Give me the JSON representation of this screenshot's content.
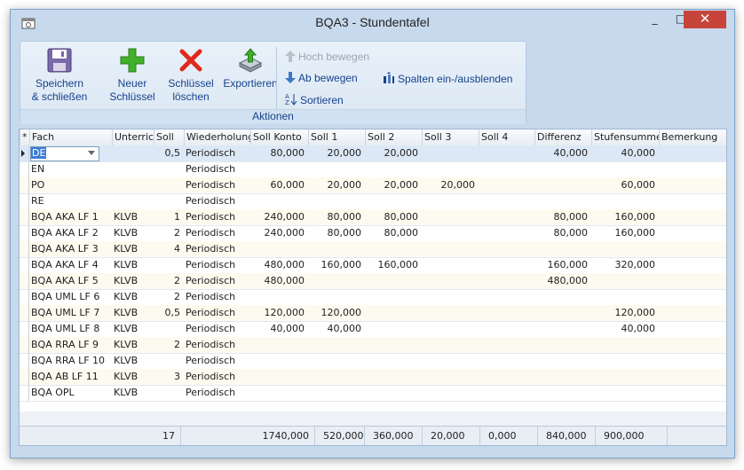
{
  "window": {
    "title": "BQA3 - Stundentafel",
    "close_glyph": "✕",
    "max_glyph": "□",
    "min_glyph": "_"
  },
  "ribbon": {
    "buttons": [
      {
        "label1": "Speichern",
        "label2": "& schließen",
        "icon": "save-icon"
      },
      {
        "label1": "Neuer",
        "label2": "Schlüssel",
        "icon": "add-icon"
      },
      {
        "label1": "Schlüssel",
        "label2": "löschen",
        "icon": "delete-icon"
      },
      {
        "label1": "Exportieren",
        "label2": "",
        "icon": "export-icon"
      }
    ],
    "move_up": "Hoch bewegen",
    "move_down": "Ab bewegen",
    "sort": "Sortieren",
    "columns": "Spalten ein-/ausblenden",
    "group": "Aktionen"
  },
  "grid": {
    "headers": [
      "*",
      "Fach",
      "Unterricht",
      "Soll",
      "Wiederholung",
      "Soll Konto",
      "Soll 1",
      "Soll 2",
      "Soll 3",
      "Soll 4",
      "Differenz",
      "Stufensumme",
      "Bemerkung"
    ],
    "rows": [
      [
        "DE",
        "",
        "0,5",
        "Periodisch",
        "80,000",
        "20,000",
        "20,000",
        "",
        "",
        "40,000",
        "40,000",
        ""
      ],
      [
        "EN",
        "",
        "",
        "Periodisch",
        "",
        "",
        "",
        "",
        "",
        "",
        "",
        ""
      ],
      [
        "PO",
        "",
        "",
        "Periodisch",
        "60,000",
        "20,000",
        "20,000",
        "20,000",
        "",
        "",
        "60,000",
        ""
      ],
      [
        "RE",
        "",
        "",
        "Periodisch",
        "",
        "",
        "",
        "",
        "",
        "",
        "",
        ""
      ],
      [
        "BQA AKA LF 1",
        "KLVB",
        "1",
        "Periodisch",
        "240,000",
        "80,000",
        "80,000",
        "",
        "",
        "80,000",
        "160,000",
        ""
      ],
      [
        "BQA AKA LF 2",
        "KLVB",
        "2",
        "Periodisch",
        "240,000",
        "80,000",
        "80,000",
        "",
        "",
        "80,000",
        "160,000",
        ""
      ],
      [
        "BQA AKA LF 3",
        "KLVB",
        "4",
        "Periodisch",
        "",
        "",
        "",
        "",
        "",
        "",
        "",
        ""
      ],
      [
        "BQA AKA LF 4",
        "KLVB",
        "",
        "Periodisch",
        "480,000",
        "160,000",
        "160,000",
        "",
        "",
        "160,000",
        "320,000",
        ""
      ],
      [
        "BQA AKA LF 5",
        "KLVB",
        "2",
        "Periodisch",
        "480,000",
        "",
        "",
        "",
        "",
        "480,000",
        "",
        ""
      ],
      [
        "BQA UML LF 6",
        "KLVB",
        "2",
        "Periodisch",
        "",
        "",
        "",
        "",
        "",
        "",
        "",
        ""
      ],
      [
        "BQA UML LF 7",
        "KLVB",
        "0,5",
        "Periodisch",
        "120,000",
        "120,000",
        "",
        "",
        "",
        "",
        "120,000",
        ""
      ],
      [
        "BQA UML LF 8",
        "KLVB",
        "",
        "Periodisch",
        "40,000",
        "40,000",
        "",
        "",
        "",
        "",
        "40,000",
        ""
      ],
      [
        "BQA RRA LF 9",
        "KLVB",
        "2",
        "Periodisch",
        "",
        "",
        "",
        "",
        "",
        "",
        "",
        ""
      ],
      [
        "BQA RRA LF 10",
        "KLVB",
        "",
        "Periodisch",
        "",
        "",
        "",
        "",
        "",
        "",
        "",
        ""
      ],
      [
        "BQA AB LF 11",
        "KLVB",
        "3",
        "Periodisch",
        "",
        "",
        "",
        "",
        "",
        "",
        "",
        ""
      ],
      [
        "BQA OPL",
        "KLVB",
        "",
        "Periodisch",
        "",
        "",
        "",
        "",
        "",
        "",
        "",
        ""
      ]
    ],
    "totals": {
      "soll": "17",
      "soll_konto": "1740,000",
      "soll1": "520,000",
      "soll2": "360,000",
      "soll3": "20,000",
      "soll4": "0,000",
      "differenz": "840,000",
      "stufensumme": "900,000"
    }
  }
}
